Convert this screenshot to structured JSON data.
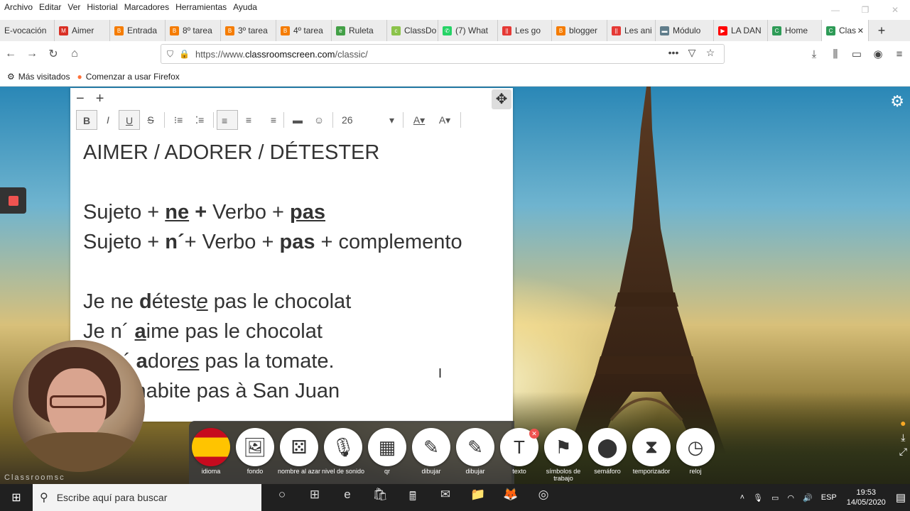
{
  "menu": [
    "Archivo",
    "Editar",
    "Ver",
    "Historial",
    "Marcadores",
    "Herramientas",
    "Ayuda"
  ],
  "window_controls": {
    "minimize": "—",
    "restore": "❐",
    "close": "✕"
  },
  "tabs": [
    {
      "label": "E-vocación",
      "icon": "",
      "color": "#ececec"
    },
    {
      "label": "Aimer",
      "icon": "M",
      "color": "#d93025"
    },
    {
      "label": "Entrada",
      "icon": "B",
      "color": "#f57c00"
    },
    {
      "label": "8º tarea",
      "icon": "B",
      "color": "#f57c00"
    },
    {
      "label": "3º tarea",
      "icon": "B",
      "color": "#f57c00"
    },
    {
      "label": "4º tarea",
      "icon": "B",
      "color": "#f57c00"
    },
    {
      "label": "Ruleta",
      "icon": "e",
      "color": "#43a047"
    },
    {
      "label": "ClassDo",
      "icon": "c",
      "color": "#8bc34a"
    },
    {
      "label": "(7) What",
      "icon": "✆",
      "color": "#25d366"
    },
    {
      "label": "Les go",
      "icon": "||",
      "color": "#e53935"
    },
    {
      "label": "blogger",
      "icon": "B",
      "color": "#f57c00"
    },
    {
      "label": "Les ani",
      "icon": "||",
      "color": "#e53935"
    },
    {
      "label": "Módulo",
      "icon": "▬",
      "color": "#607d8b"
    },
    {
      "label": "LA DAN",
      "icon": "▶",
      "color": "#ff0000"
    },
    {
      "label": "Home",
      "icon": "C",
      "color": "#2e9b57"
    },
    {
      "label": "Clas",
      "icon": "C",
      "color": "#2e9b57"
    }
  ],
  "new_tab_label": "+",
  "nav": {
    "back": "←",
    "forward": "→",
    "reload": "↻",
    "home": "⌂"
  },
  "url": {
    "prefix": "https://www.",
    "domain": "classroomscreen.com",
    "path": "/classic/"
  },
  "url_icons": {
    "more": "•••",
    "pocket": "▽",
    "bookmark": "☆"
  },
  "right_nav": {
    "download": "⤓",
    "library": "⫼",
    "sidebar": "▭",
    "account": "◉",
    "menu": "≡"
  },
  "bookmarks": [
    {
      "label": "Más visitados",
      "icon": "⚙"
    },
    {
      "label": "Comenzar a usar Firefox",
      "icon": "●"
    }
  ],
  "editor": {
    "zoom_out": "−",
    "zoom_in": "+",
    "move": "✥",
    "font_size": "26",
    "font_size_caret": "▾",
    "toolbar": {
      "bold": "B",
      "italic": "I",
      "underline": "U",
      "strike": "S",
      "olist": "⁝≡",
      "ulist": "⁚≡",
      "left": "≡",
      "center": "≡",
      "right": "≡",
      "rule": "▬",
      "emoji": "☺",
      "color": "A▾",
      "bg": "A▾"
    },
    "lines": [
      "AIMER / ADORER / DÉTESTER",
      "",
      "Sujeto + ne + Verbo + pas",
      "Sujeto + n´+ Verbo + pas + complemento",
      "",
      "Je ne déteste pas le chocolat",
      "Je n´ aime pas le chocolat",
      "Tu n´ adores pas la tomate.",
      "Je n´ habite pas à San Juan"
    ]
  },
  "watermark": "Classroomsc",
  "dock": [
    {
      "label": "idioma",
      "icon": "🇪🇸"
    },
    {
      "label": "fondo",
      "icon": "🖼"
    },
    {
      "label": "nombre al azar",
      "icon": "⚄"
    },
    {
      "label": "nivel de sonido",
      "icon": "🎙"
    },
    {
      "label": "qr",
      "icon": "▦"
    },
    {
      "label": "dibujar",
      "icon": "✎"
    },
    {
      "label": "dibujar",
      "icon": "✎"
    },
    {
      "label": "texto",
      "icon": "T"
    },
    {
      "label": "símbolos de trabajo",
      "icon": "⚑"
    },
    {
      "label": "semáforo",
      "icon": "⬤"
    },
    {
      "label": "temporizador",
      "icon": "⧗"
    },
    {
      "label": "reloj",
      "icon": "◷"
    }
  ],
  "texto_badge": "✕",
  "taskbar": {
    "search_placeholder": "Escribe aquí para buscar",
    "apps": [
      "○",
      "⊞",
      "e",
      "🛍",
      "🖩",
      "✉",
      "📁",
      "🦊",
      "◎"
    ],
    "lang": "ESP",
    "time": "19:53",
    "date": "14/05/2020"
  }
}
